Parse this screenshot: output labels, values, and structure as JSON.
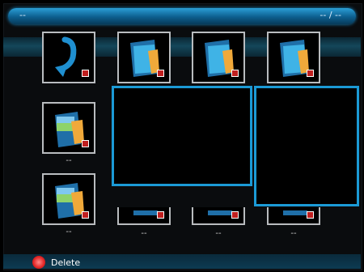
{
  "header": {
    "title": "--",
    "page_indicator": "-- / --"
  },
  "grid": {
    "items": [
      {
        "icon": "back-arrow-icon"
      },
      {
        "icon": "folder-icon"
      },
      {
        "icon": "folder-icon"
      },
      {
        "icon": "folder-icon"
      },
      {
        "icon": "photo-folder-icon",
        "caption": "--"
      },
      {
        "icon": "photo-folder-icon",
        "caption": "--"
      },
      {
        "icon": "thumbnail-icon",
        "caption": "--"
      },
      {
        "icon": "thumbnail-icon",
        "caption": "--"
      },
      {
        "icon": "thumbnail-icon",
        "caption": "--"
      }
    ]
  },
  "footer": {
    "delete_label": "Delete"
  },
  "colors": {
    "accent": "#1b9ad6",
    "delete": "#e02323"
  }
}
